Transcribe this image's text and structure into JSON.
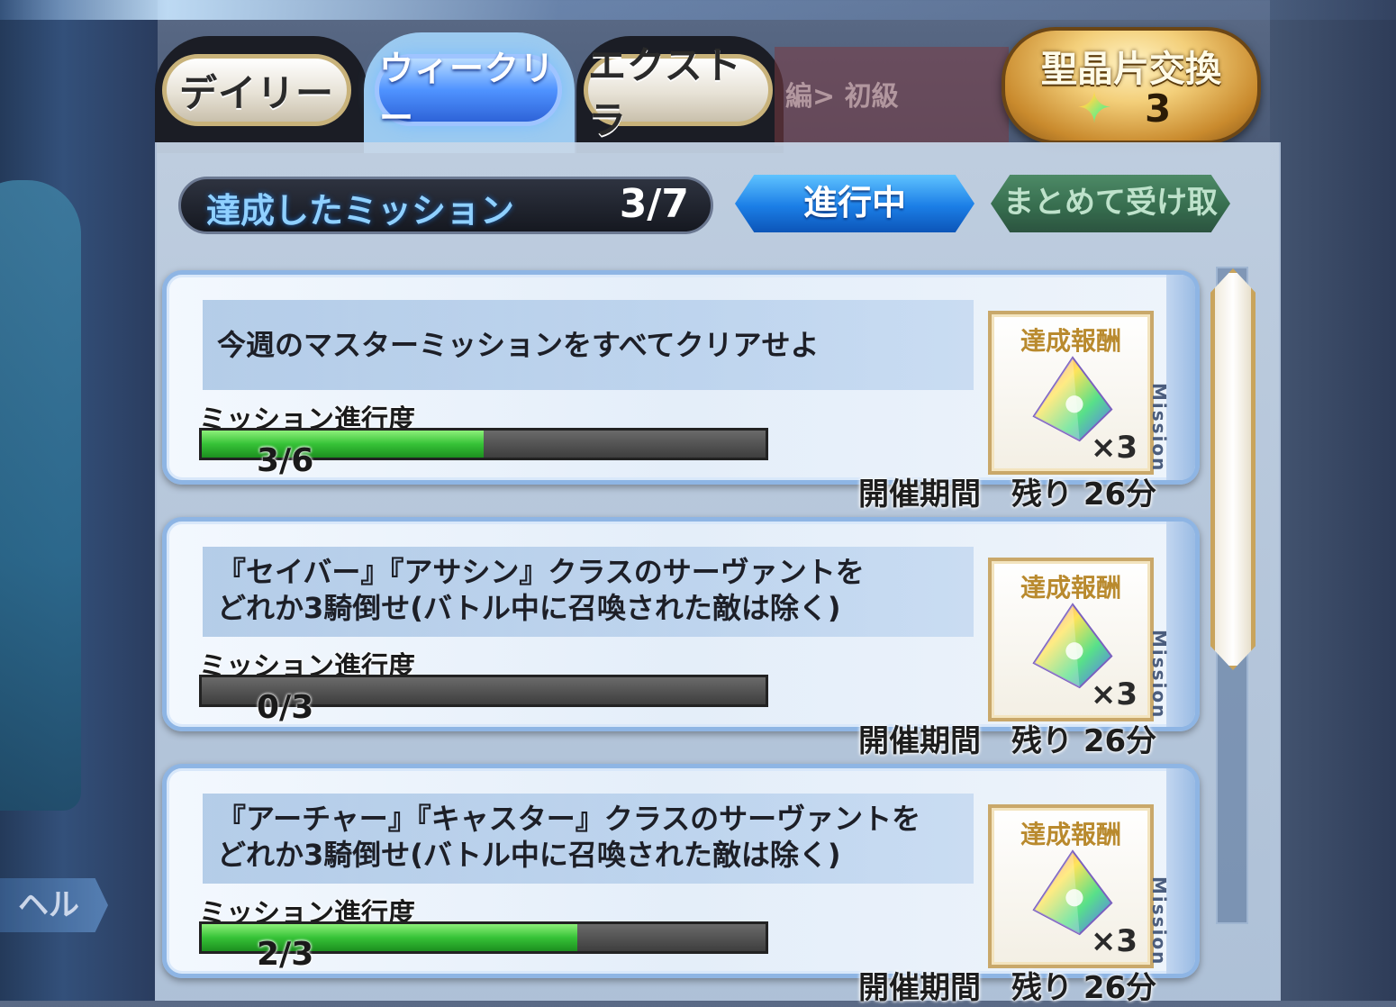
{
  "tabs": [
    {
      "label": "デイリー",
      "active": false
    },
    {
      "label": "ウィークリー",
      "active": true
    },
    {
      "label": "エクストラ",
      "active": false
    }
  ],
  "background_header": {
    "text": "編> 初級"
  },
  "exchange": {
    "label": "聖晶片交換",
    "count": "3",
    "icon": "star-icon"
  },
  "summary": {
    "label": "達成したミッション",
    "value": "3/7"
  },
  "filter_button": {
    "label": "進行中"
  },
  "claim_all_button": {
    "label": "まとめて受け取る"
  },
  "help": {
    "label": "ヘルプ"
  },
  "missions": [
    {
      "description": "今週のマスターミッションをすべてクリアせよ",
      "progress_label": "ミッション進行度",
      "progress_text": "3/6",
      "progress": 0.5,
      "reward_label": "達成報酬",
      "reward_icon": "saint-quartz-icon",
      "reward_qty": "×3",
      "side_label": "Mission",
      "period": "開催期間　残り 26分"
    },
    {
      "description": "『セイバー』『アサシン』クラスのサーヴァントを\nどれか3騎倒せ(バトル中に召喚された敵は除く)",
      "progress_label": "ミッション進行度",
      "progress_text": "0/3",
      "progress": 0.0,
      "reward_label": "達成報酬",
      "reward_icon": "saint-quartz-icon",
      "reward_qty": "×3",
      "side_label": "Mission",
      "period": "開催期間　残り 26分"
    },
    {
      "description": "『アーチャー』『キャスター』クラスのサーヴァントを\nどれか3騎倒せ(バトル中に召喚された敵は除く)",
      "progress_label": "ミッション進行度",
      "progress_text": "2/3",
      "progress": 0.6667,
      "reward_label": "達成報酬",
      "reward_icon": "saint-quartz-icon",
      "reward_qty": "×3",
      "side_label": "Mission",
      "period": "開催期間　残り 26分"
    }
  ]
}
